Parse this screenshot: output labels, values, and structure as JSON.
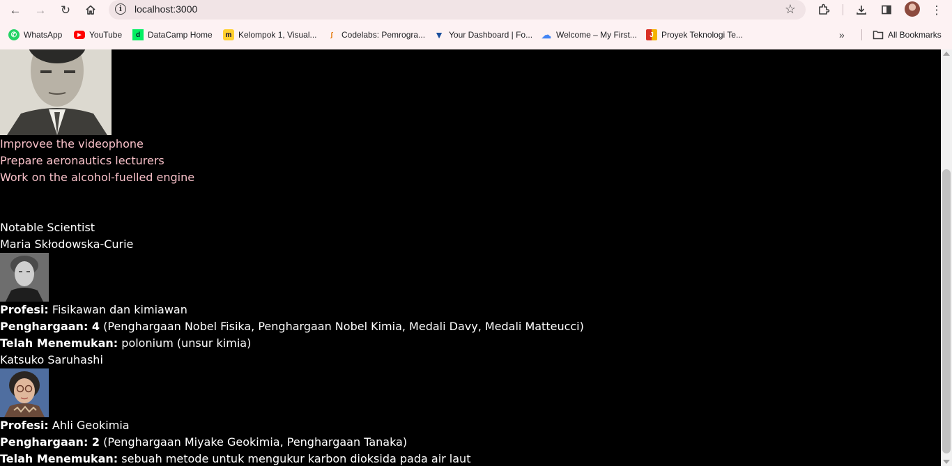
{
  "browser": {
    "url": "localhost:3000",
    "bookmarks": [
      {
        "label": "WhatsApp",
        "icon": "whatsapp-icon",
        "color": "#25d366"
      },
      {
        "label": "YouTube",
        "icon": "youtube-icon",
        "color": "#ff0000"
      },
      {
        "label": "DataCamp Home",
        "icon": "datacamp-icon",
        "color": "#03ef62"
      },
      {
        "label": "Kelompok 1, Visual...",
        "icon": "miro-icon",
        "color": "#ffd02f"
      },
      {
        "label": "Codelabs: Pemrogra...",
        "icon": "codelabs-icon",
        "color": "#e37400"
      },
      {
        "label": "Your Dashboard | Fo...",
        "icon": "dashboard-icon",
        "color": "#1a4f9c"
      },
      {
        "label": "Welcome – My First...",
        "icon": "google-cloud-icon",
        "color": "#4285f4"
      },
      {
        "label": "Proyek Teknologi Te...",
        "icon": "proyek-icon",
        "color": "#d93025"
      }
    ],
    "all_bookmarks_label": "All Bookmarks"
  },
  "page": {
    "todos": [
      "Improvee the videophone",
      "Prepare aeronautics lecturers",
      "Work on the alcohol-fuelled engine"
    ],
    "heading": "Notable Scientist",
    "scientists": [
      {
        "name": "Maria Skłodowska-Curie",
        "profesi_label": "Profesi:",
        "profesi": "Fisikawan dan kimiawan",
        "penghargaan_label": "Penghargaan: 4",
        "penghargaan": "(Penghargaan Nobel Fisika, Penghargaan Nobel Kimia, Medali Davy, Medali Matteucci)",
        "temuan_label": "Telah Menemukan:",
        "temuan": "polonium (unsur kimia)"
      },
      {
        "name": "Katsuko Saruhashi",
        "profesi_label": "Profesi:",
        "profesi": "Ahli Geokimia",
        "penghargaan_label": "Penghargaan: 2",
        "penghargaan": "(Penghargaan Miyake Geokimia, Penghargaan Tanaka)",
        "temuan_label": "Telah Menemukan:",
        "temuan": "sebuah metode untuk mengukur karbon dioksida pada air laut"
      }
    ]
  },
  "colors": {
    "todo_text": "#f8c0c8",
    "page_bg": "#000000",
    "chrome_bg": "#fdf2f3"
  }
}
